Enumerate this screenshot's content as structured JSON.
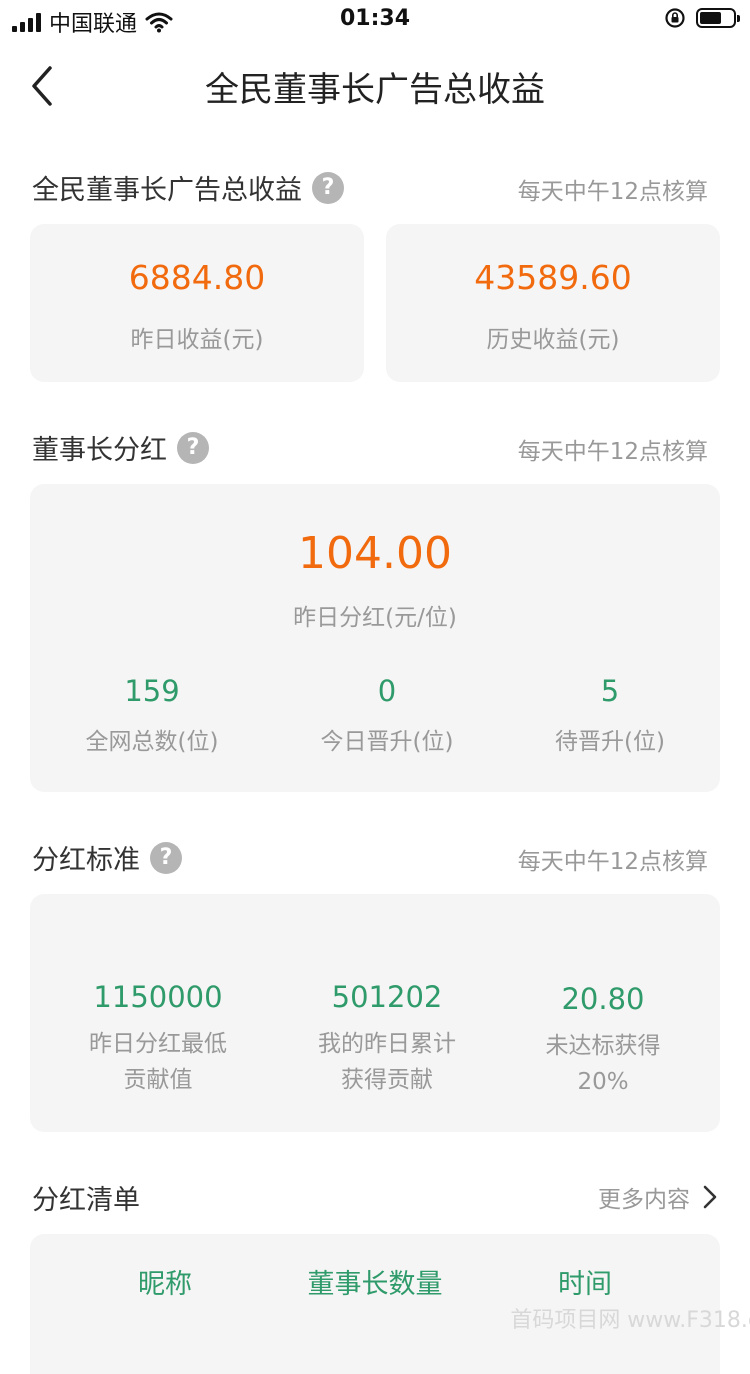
{
  "status": {
    "carrier": "中国联通",
    "time": "01:34",
    "battery_level": 0.65
  },
  "nav": {
    "title": "全民董事长广告总收益"
  },
  "income": {
    "title": "全民董事长广告总收益",
    "note": "每天中午12点核算",
    "yesterday": {
      "value": "6884.80",
      "label": "昨日收益(元)"
    },
    "history": {
      "value": "43589.60",
      "label": "历史收益(元)"
    }
  },
  "dividend": {
    "title": "董事长分红",
    "note": "每天中午12点核算",
    "main": {
      "value": "104.00",
      "label": "昨日分红(元/位)"
    },
    "stats": [
      {
        "value": "159",
        "label": "全网总数(位)"
      },
      {
        "value": "0",
        "label": "今日晋升(位)"
      },
      {
        "value": "5",
        "label": "待晋升(位)"
      }
    ]
  },
  "standard": {
    "title": "分红标准",
    "note": "每天中午12点核算",
    "items": [
      {
        "value": "1150000",
        "label1": "昨日分红最低",
        "label2": "贡献值"
      },
      {
        "value": "501202",
        "label1": "我的昨日累计",
        "label2": "获得贡献"
      },
      {
        "value": "20.80",
        "label1": "未达标获得",
        "label2": "20%"
      }
    ]
  },
  "list": {
    "title": "分红清单",
    "more": "更多内容",
    "columns": [
      "昵称",
      "董事长数量",
      "时间"
    ]
  },
  "watermark": "首码项目网 www.F318.c"
}
